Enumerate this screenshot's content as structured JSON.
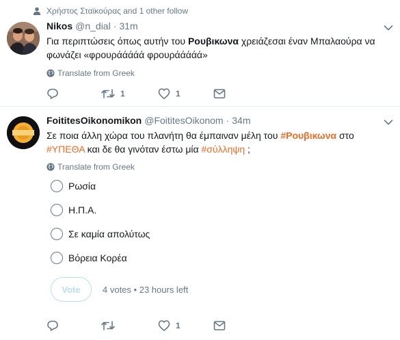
{
  "tweet1": {
    "social_context": "Χρήστος Σταϊκούρας and 1 other follow",
    "name": "Nikos",
    "handle": "@n_dial",
    "time": "31m",
    "text": {
      "line1_before": "Για περιπτώσεις όπως αυτήν του ",
      "line1_bold": "Ρουβικωνα",
      "line1_after": " χρειάζεσαι έναν Μπαλαούρα να",
      "line2": "φωνάζει «φρουράάάάά φρουράάάάά»"
    },
    "translate": "Translate from Greek",
    "actions": {
      "reply": "",
      "retweet": "1",
      "like": "1"
    }
  },
  "tweet2": {
    "name": "FoititesOikonomikon",
    "handle": "@FoititesOikonom",
    "time": "34m",
    "text": {
      "p1": "Σε ποια άλλη χώρα του πλανήτη θα έμπαιναν μέλη του ",
      "h1": "#Ρουβικωνα",
      "p2": " στο",
      "h2": "#ΥΠΕΘΑ",
      "p3": " και δε θα γινόταν έστω μία ",
      "h3": "#σύλληψη",
      "p4": " ;"
    },
    "translate": "Translate from Greek",
    "poll": {
      "options": [
        "Ρωσία",
        "Η.Π.Α.",
        "Σε καμία απολύτως",
        "Βόρεια Κορέα"
      ],
      "vote_label": "Vote",
      "votes": "4 votes",
      "sep": "•",
      "time_left": "23 hours left"
    },
    "actions": {
      "reply": "",
      "retweet": "",
      "like": "1"
    }
  },
  "colors": {
    "hashtag": "#f56a22",
    "secondary_text": "#657786",
    "vote_disabled": "#b9def4",
    "divider": "#e6ecf0"
  },
  "icons": [
    "person-icon",
    "chevron-down-icon",
    "globe-icon",
    "reply-icon",
    "retweet-icon",
    "heart-icon",
    "message-icon"
  ]
}
